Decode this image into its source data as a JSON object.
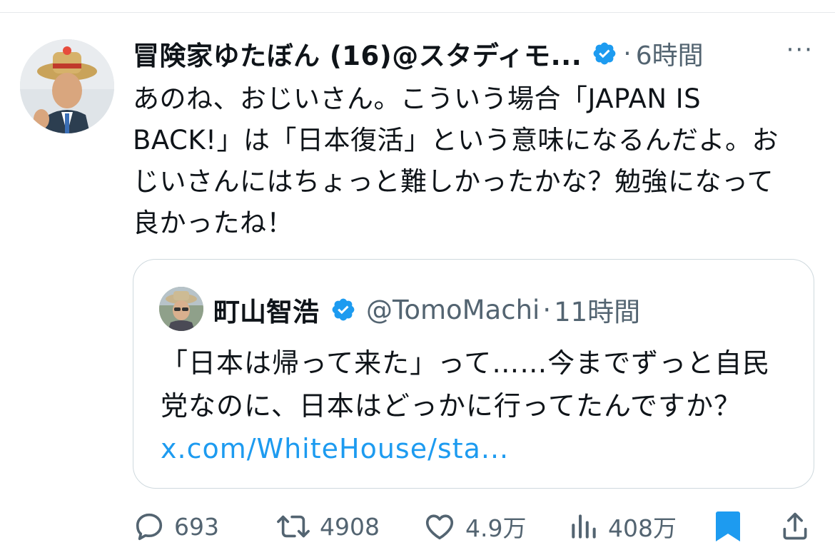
{
  "tweet": {
    "author_name": "冒険家ゆたぼん (16)@スタディモ...",
    "separator": "·",
    "time": "6時間",
    "more": "···",
    "text": "あのね、おじいさん。こういう場合「JAPAN IS BACK!」は「日本復活」という意味になるんだよ。おじいさんにはちょっと難しかったかな？勉強になって良かったね！"
  },
  "quote": {
    "author_name": "町山智浩",
    "handle": "@TomoMachi",
    "separator": "·",
    "time": "11時間",
    "text": "「日本は帰って来た」って……今までずっと自民党なのに、日本はどっかに行ってたんですか？ ",
    "link": "x.com/WhiteHouse/sta..."
  },
  "actions": {
    "replies": "693",
    "retweets": "4908",
    "likes": "4.9万",
    "views": "408万"
  },
  "colors": {
    "accent": "#1d9bf0",
    "muted": "#536471",
    "text": "#0f1419",
    "border": "#cfd9de"
  }
}
